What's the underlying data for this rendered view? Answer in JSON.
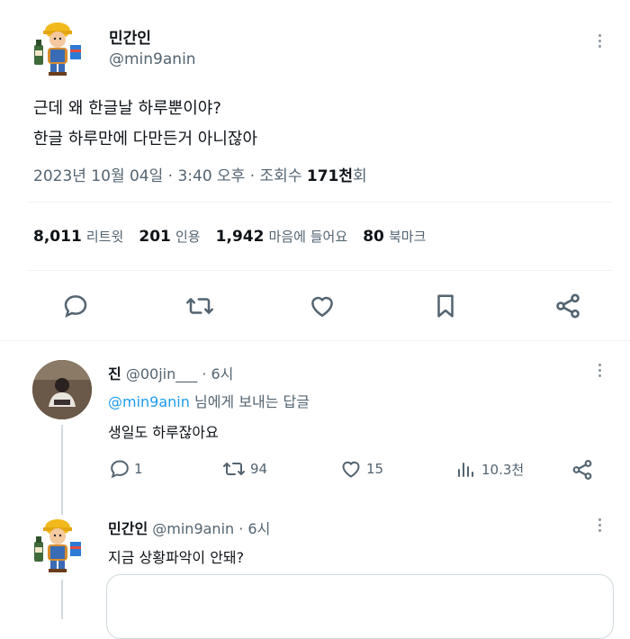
{
  "tweet": {
    "display_name": "민간인",
    "handle": "@min9anin",
    "text_line1": "근데 왜 한글날 하루뿐이야?",
    "text_line2": "한글 하루만에 다만든거 아니잖아",
    "timestamp": "2023년 10월 04일 · 3:40 오후 · 조회수 ",
    "views": "171천",
    "views_suffix": "회"
  },
  "stats": {
    "retweets_num": "8,011",
    "retweets_label": "리트윗",
    "quotes_num": "201",
    "quotes_label": "인용",
    "likes_num": "1,942",
    "likes_label": "마음에 들어요",
    "bookmarks_num": "80",
    "bookmarks_label": "북마크"
  },
  "reply1": {
    "display_name": "진",
    "handle": "@00jin___",
    "time": "· 6시",
    "replying_to": "@min9anin",
    "replying_suffix": "님에게 보내는 답글",
    "text": "생일도 하루잖아요",
    "reply_count": "1",
    "retweet_count": "94",
    "like_count": "15",
    "view_count": "10.3천"
  },
  "reply2": {
    "display_name": "민간인",
    "handle": "@min9anin",
    "time": "· 6시",
    "text": "지금 상황파악이 안돼?"
  },
  "colors": {
    "link": "#1d9bf0",
    "muted": "#536471",
    "thread_line": "#cfd9de"
  },
  "icons": [
    "reply-icon",
    "retweet-icon",
    "like-icon",
    "bookmark-icon",
    "share-icon",
    "more-icon",
    "views-icon"
  ]
}
